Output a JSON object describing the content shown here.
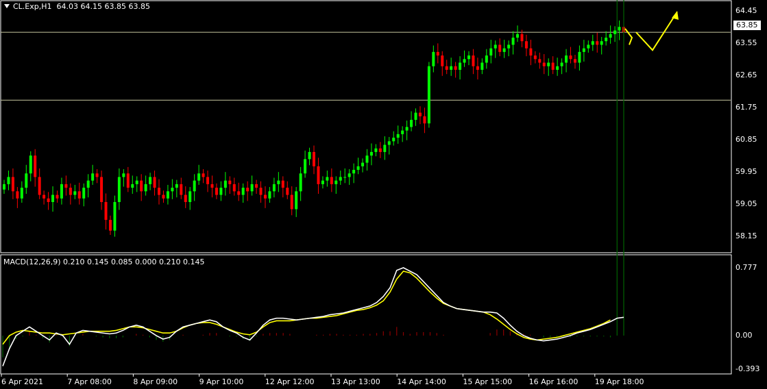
{
  "header": {
    "symbol_tf": "CL.Exp,H1",
    "ohlc": "64.03 64.15 63.85 63.85"
  },
  "macd": {
    "label": "MACD(12,26,9) 0.210 0.145 0.085 0.000 0.210 0.145"
  },
  "current_price_label": "63.85",
  "price_axis": [
    "64.45",
    "63.55",
    "62.65",
    "61.75",
    "60.85",
    "59.95",
    "59.05",
    "58.15"
  ],
  "macd_axis": [
    "0.777",
    "0.00",
    "-0.393"
  ],
  "time_axis": [
    "6 Apr 2021",
    "7 Apr 08:00",
    "8 Apr 09:00",
    "9 Apr 10:00",
    "12 Apr 12:00",
    "13 Apr 13:00",
    "14 Apr 14:00",
    "15 Apr 15:00",
    "16 Apr 16:00",
    "19 Apr 18:00"
  ],
  "colors": {
    "bull": "#00ff00",
    "bear": "#ff0000",
    "macd_line": "#ffffff",
    "signal_line": "#ffff00",
    "hist_pos": "#8b0000",
    "hist_neg": "#006400",
    "hline": "#c8c8a0",
    "arrow": "#ffff00"
  },
  "horizontal_lines": [
    63.85,
    61.95
  ],
  "chart_data": {
    "type": "candlestick",
    "price_range": [
      57.95,
      64.6
    ],
    "macd_range": [
      -0.393,
      0.85
    ],
    "close_series": [
      59.6,
      59.8,
      59.4,
      59.2,
      59.5,
      59.9,
      60.4,
      59.8,
      59.3,
      59.2,
      59.1,
      59.3,
      59.2,
      59.6,
      59.5,
      59.3,
      59.4,
      59.2,
      59.5,
      59.7,
      59.9,
      59.8,
      59.1,
      58.6,
      58.3,
      59.1,
      59.8,
      59.9,
      59.5,
      59.6,
      59.7,
      59.4,
      59.6,
      59.8,
      59.5,
      59.3,
      59.2,
      59.4,
      59.5,
      59.6,
      59.3,
      59.1,
      59.4,
      59.7,
      59.9,
      59.8,
      59.6,
      59.5,
      59.3,
      59.5,
      59.7,
      59.6,
      59.4,
      59.3,
      59.5,
      59.4,
      59.6,
      59.5,
      59.3,
      59.2,
      59.4,
      59.6,
      59.7,
      59.5,
      59.3,
      58.9,
      59.4,
      59.9,
      60.3,
      60.5,
      60.1,
      59.6,
      59.7,
      59.8,
      59.6,
      59.7,
      59.8,
      59.8,
      59.9,
      60.0,
      60.1,
      60.2,
      60.4,
      60.5,
      60.6,
      60.5,
      60.7,
      60.8,
      60.9,
      61.0,
      61.1,
      61.2,
      61.4,
      61.6,
      61.5,
      61.3,
      62.9,
      63.3,
      63.2,
      62.9,
      62.8,
      62.9,
      62.8,
      63.0,
      63.1,
      63.2,
      62.9,
      62.8,
      63.0,
      63.2,
      63.4,
      63.5,
      63.3,
      63.4,
      63.5,
      63.7,
      63.8,
      63.6,
      63.4,
      63.2,
      63.1,
      63.0,
      62.9,
      63.0,
      62.8,
      62.9,
      63.0,
      63.2,
      63.1,
      63.0,
      63.3,
      63.4,
      63.5,
      63.6,
      63.5,
      63.6,
      63.7,
      63.8,
      63.9,
      64.0,
      63.85
    ],
    "macd_series": [
      -0.35,
      -0.15,
      0.0,
      0.05,
      0.1,
      0.05,
      0.0,
      -0.05,
      0.03,
      0.0,
      -0.1,
      0.03,
      0.06,
      0.05,
      0.04,
      0.03,
      0.02,
      0.03,
      0.06,
      0.1,
      0.12,
      0.1,
      0.05,
      0.0,
      -0.04,
      -0.02,
      0.05,
      0.1,
      0.12,
      0.14,
      0.16,
      0.18,
      0.16,
      0.1,
      0.06,
      0.03,
      -0.02,
      -0.05,
      0.03,
      0.12,
      0.18,
      0.2,
      0.2,
      0.19,
      0.18,
      0.19,
      0.2,
      0.21,
      0.22,
      0.24,
      0.25,
      0.26,
      0.28,
      0.3,
      0.32,
      0.34,
      0.38,
      0.45,
      0.55,
      0.75,
      0.78,
      0.74,
      0.7,
      0.62,
      0.54,
      0.46,
      0.38,
      0.34,
      0.31,
      0.3,
      0.29,
      0.28,
      0.27,
      0.27,
      0.26,
      0.2,
      0.12,
      0.05,
      0.0,
      -0.03,
      -0.05,
      -0.06,
      -0.05,
      -0.04,
      -0.02,
      0.0,
      0.03,
      0.05,
      0.07,
      0.1,
      0.13,
      0.16,
      0.2,
      0.21
    ],
    "signal_series": [
      -0.1,
      0.0,
      0.04,
      0.06,
      0.05,
      0.04,
      0.03,
      0.03,
      0.02,
      0.01,
      0.02,
      0.03,
      0.04,
      0.05,
      0.05,
      0.05,
      0.05,
      0.06,
      0.08,
      0.1,
      0.1,
      0.09,
      0.07,
      0.05,
      0.03,
      0.03,
      0.05,
      0.09,
      0.12,
      0.14,
      0.15,
      0.15,
      0.13,
      0.1,
      0.07,
      0.04,
      0.02,
      0.01,
      0.04,
      0.1,
      0.15,
      0.17,
      0.17,
      0.17,
      0.18,
      0.19,
      0.2,
      0.2,
      0.21,
      0.22,
      0.23,
      0.25,
      0.27,
      0.29,
      0.3,
      0.32,
      0.35,
      0.4,
      0.5,
      0.65,
      0.74,
      0.72,
      0.66,
      0.58,
      0.5,
      0.43,
      0.37,
      0.34,
      0.31,
      0.3,
      0.29,
      0.28,
      0.27,
      0.24,
      0.19,
      0.13,
      0.07,
      0.02,
      -0.02,
      -0.04,
      -0.05,
      -0.04,
      -0.03,
      -0.02,
      0.0,
      0.02,
      0.04,
      0.06,
      0.08,
      0.11,
      0.14,
      0.18
    ]
  }
}
